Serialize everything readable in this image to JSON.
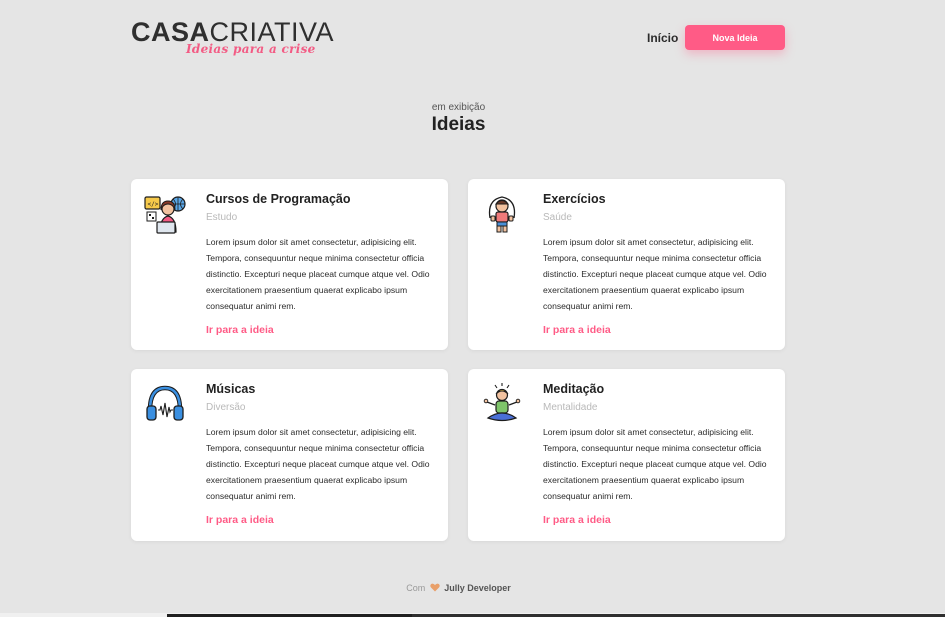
{
  "brand": {
    "name_bold": "CASA",
    "name_light": "CRIATIVA",
    "tagline": "Ideias para a crise",
    "accent_color": "#ff5b86"
  },
  "nav": {
    "home_label": "Início",
    "new_idea_label": "Nova Ideia"
  },
  "section": {
    "subtitle": "em exibição",
    "title": "Ideias"
  },
  "ideas": [
    {
      "icon": "programmer-icon",
      "title": "Cursos de Programação",
      "category": "Estudo",
      "description": "Lorem ipsum dolor sit amet consectetur, adipisicing elit. Tempora, consequuntur neque minima consectetur officia distinctio. Excepturi neque placeat cumque atque vel. Odio exercitationem praesentium quaerat explicabo ipsum consequatur animi rem.",
      "link": "Ir para a ideia"
    },
    {
      "icon": "jump-rope-icon",
      "title": "Exercícios",
      "category": "Saúde",
      "description": "Lorem ipsum dolor sit amet consectetur, adipisicing elit. Tempora, consequuntur neque minima consectetur officia distinctio. Excepturi neque placeat cumque atque vel. Odio exercitationem praesentium quaerat explicabo ipsum consequatur animi rem.",
      "link": "Ir para a ideia"
    },
    {
      "icon": "headphones-icon",
      "title": "Músicas",
      "category": "Diversão",
      "description": "Lorem ipsum dolor sit amet consectetur, adipisicing elit. Tempora, consequuntur neque minima consectetur officia distinctio. Excepturi neque placeat cumque atque vel. Odio exercitationem praesentium quaerat explicabo ipsum consequatur animi rem.",
      "link": "Ir para a ideia"
    },
    {
      "icon": "meditation-icon",
      "title": "Meditação",
      "category": "Mentalidade",
      "description": "Lorem ipsum dolor sit amet consectetur, adipisicing elit. Tempora, consequuntur neque minima consectetur officia distinctio. Excepturi neque placeat cumque atque vel. Odio exercitationem praesentium quaerat explicabo ipsum consequatur animi rem.",
      "link": "Ir para a ideia"
    }
  ],
  "footer": {
    "prefix": "Com",
    "heart_icon": "heart-icon",
    "author": "Jully Developer"
  }
}
